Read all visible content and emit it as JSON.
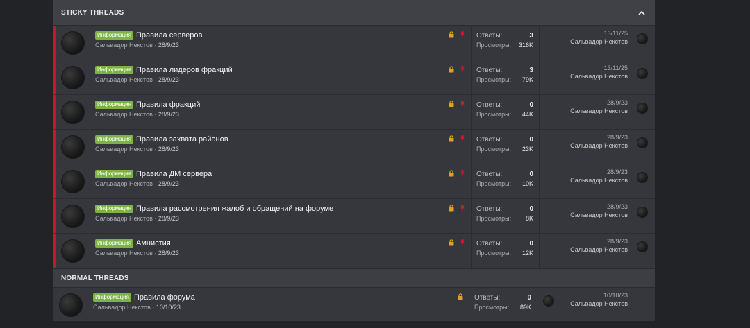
{
  "sticky_header": {
    "label": "STICKY THREADS"
  },
  "normal_header": {
    "label": "NORMAL THREADS"
  },
  "labels": {
    "replies": "Ответы:",
    "views": "Просмотры:"
  },
  "sticky_threads": [
    {
      "prefix": "Информация",
      "title": "Правила серверов",
      "author": "Сальвадор Некстов",
      "date": "28/9/23",
      "replies": "3",
      "views": "316K",
      "last_date": "13/11/25",
      "last_user": "Сальвадор Некстов"
    },
    {
      "prefix": "Информация",
      "title": "Правила лидеров фракций",
      "author": "Сальвадор Некстов",
      "date": "28/9/23",
      "replies": "3",
      "views": "79K",
      "last_date": "13/11/25",
      "last_user": "Сальвадор Некстов"
    },
    {
      "prefix": "Информация",
      "title": "Правила фракций",
      "author": "Сальвадор Некстов",
      "date": "28/9/23",
      "replies": "0",
      "views": "44K",
      "last_date": "28/9/23",
      "last_user": "Сальвадор Некстов"
    },
    {
      "prefix": "Информация",
      "title": "Правила захвата районов",
      "author": "Сальвадор Некстов",
      "date": "28/9/23",
      "replies": "0",
      "views": "23K",
      "last_date": "28/9/23",
      "last_user": "Сальвадор Некстов"
    },
    {
      "prefix": "Информация",
      "title": "Правила ДМ сервера",
      "author": "Сальвадор Некстов",
      "date": "28/9/23",
      "replies": "0",
      "views": "10K",
      "last_date": "28/9/23",
      "last_user": "Сальвадор Некстов"
    },
    {
      "prefix": "Информация",
      "title": "Правила рассмотрения жалоб и обращений на форуме",
      "author": "Сальвадор Некстов",
      "date": "28/9/23",
      "replies": "0",
      "views": "8K",
      "last_date": "28/9/23",
      "last_user": "Сальвадор Некстов"
    },
    {
      "prefix": "Информация",
      "title": "Амнистия",
      "author": "Сальвадор Некстов",
      "date": "28/9/23",
      "replies": "0",
      "views": "12K",
      "last_date": "28/9/23",
      "last_user": "Сальвадор Некстов"
    }
  ],
  "normal_threads": [
    {
      "prefix": "Информация",
      "title": "Правила форума",
      "author": "Сальвадор Некстов",
      "date": "10/10/23",
      "replies": "0",
      "views": "89K",
      "last_date": "10/10/23",
      "last_user": "Сальвадор Некстов"
    }
  ],
  "colors": {
    "prefix_bg": "#7cb342",
    "sticky_accent": "#c2182c",
    "lock": "#e0a024",
    "pin": "#d81b2c"
  },
  "icons": {
    "collapse": "chevron-up-icon",
    "lock": "lock-icon",
    "pin": "thumbtack-icon"
  }
}
